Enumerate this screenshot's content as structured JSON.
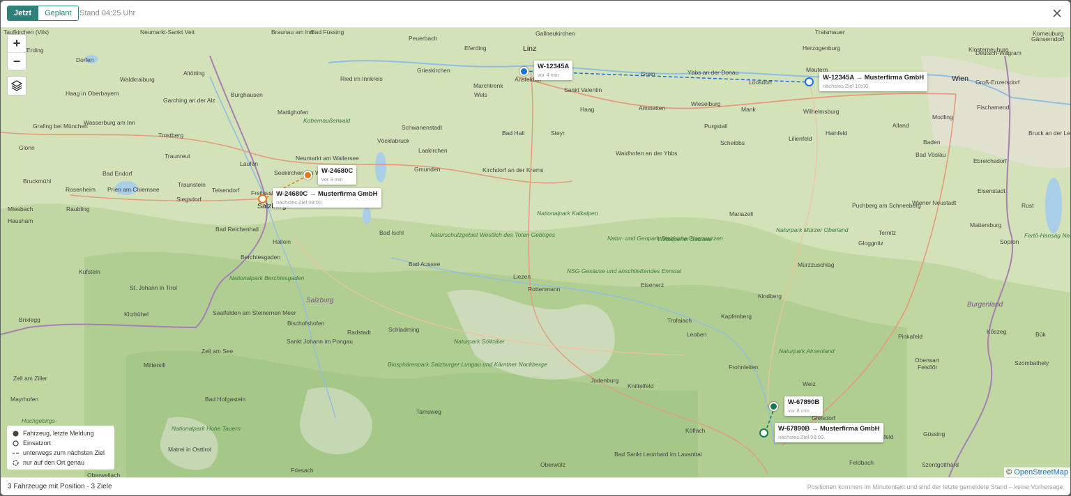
{
  "header": {
    "tabs": [
      {
        "label": "Jetzt"
      },
      {
        "label": "Geplant"
      }
    ],
    "stand": "Stand 04:25 Uhr"
  },
  "map": {
    "zoom_in": "+",
    "zoom_out": "−",
    "attribution_prefix": "©",
    "attribution_link": "OpenStreetMap",
    "places": [
      {
        "name": "Taufkirchen (Vils)"
      },
      {
        "name": "Neumarkt-Sankt Veit"
      },
      {
        "name": "Erding"
      },
      {
        "name": "Dorfen"
      },
      {
        "name": "Braunau am Inn"
      },
      {
        "name": "Bad Füssing"
      },
      {
        "name": "Peuerbach"
      },
      {
        "name": "Gallneukirchen"
      },
      {
        "name": "Traismauer"
      },
      {
        "name": "Korneuburg"
      },
      {
        "name": "Gänserndorf"
      },
      {
        "name": "Linz"
      },
      {
        "name": "Herzogenburg"
      },
      {
        "name": "Klosterneuburg"
      },
      {
        "name": "Deutsch-Wagram"
      },
      {
        "name": "Altötting"
      },
      {
        "name": "Eferding"
      },
      {
        "name": "Grieskirchen"
      },
      {
        "name": "Ansfelden"
      },
      {
        "name": "Grein"
      },
      {
        "name": "Melk"
      },
      {
        "name": "Waldkraiburg"
      },
      {
        "name": "Ried im Innkreis"
      },
      {
        "name": "Mautern"
      },
      {
        "name": "Ybbs an der Donau"
      },
      {
        "name": "Loosdorf"
      },
      {
        "name": "Wien"
      },
      {
        "name": "Groß-Enzersdorf"
      },
      {
        "name": "Haag in Oberbayern"
      },
      {
        "name": "Burghausen"
      },
      {
        "name": "Marchtrenk"
      },
      {
        "name": "Wels"
      },
      {
        "name": "Sankt Valentin"
      },
      {
        "name": "Haag"
      },
      {
        "name": "Amstetten"
      },
      {
        "name": "Wieselburg"
      },
      {
        "name": "Mank"
      },
      {
        "name": "Wilhelmsburg"
      },
      {
        "name": "Fischamend"
      },
      {
        "name": "Garching an der Alz"
      },
      {
        "name": "Mattighofen"
      },
      {
        "name": "Kobernaußerwald"
      },
      {
        "name": "Schwanenstadt"
      },
      {
        "name": "Wasserburg am Inn"
      },
      {
        "name": "Modling"
      },
      {
        "name": "Steyr"
      },
      {
        "name": "Bad Hall"
      },
      {
        "name": "Purgstall"
      },
      {
        "name": "Hainfeld"
      },
      {
        "name": "Alland"
      },
      {
        "name": "Grafing bei München"
      },
      {
        "name": "Trostberg"
      },
      {
        "name": "Vöcklabruck"
      },
      {
        "name": "Laakirchen"
      },
      {
        "name": "Scheibbs"
      },
      {
        "name": "Lilienfeld"
      },
      {
        "name": "Bruck an der Leitha"
      },
      {
        "name": "Glonn"
      },
      {
        "name": "Traunreut"
      },
      {
        "name": "Waidhofen an der Ybbs"
      },
      {
        "name": "Baden"
      },
      {
        "name": "Bad Vöslau"
      },
      {
        "name": "Neumarkt am Wallersee"
      },
      {
        "name": "Seekirchen am Wallersee"
      },
      {
        "name": "Gmunden"
      },
      {
        "name": "Kirchdorf an der Krems"
      },
      {
        "name": "Ebreichsdorf"
      },
      {
        "name": "Laufen"
      },
      {
        "name": "Bad Endorf"
      },
      {
        "name": "Bruckmühl"
      },
      {
        "name": "Traunstein"
      },
      {
        "name": "Rosenheim"
      },
      {
        "name": "Prien am Chiemsee"
      },
      {
        "name": "Teisendorf"
      },
      {
        "name": "Freilassing"
      },
      {
        "name": "Siegsdorf"
      },
      {
        "name": "Salzburg"
      },
      {
        "name": "Eisenstadt"
      },
      {
        "name": "Miesbach"
      },
      {
        "name": "Raubling"
      },
      {
        "name": "Hausham"
      },
      {
        "name": "Nationalpark Kalkalpen"
      },
      {
        "name": "Puchberg am Schneeberg"
      },
      {
        "name": "Wiener Neustadt"
      },
      {
        "name": "Rust"
      },
      {
        "name": "Mariazell"
      },
      {
        "name": "Bad Reichenhall"
      },
      {
        "name": "Bad Ischl"
      },
      {
        "name": "Naturpark Mürzer Oberland"
      },
      {
        "name": "Mattersburg"
      },
      {
        "name": "Naturschutzgebiet Westlich des Toten Gebirges"
      },
      {
        "name": "Hallein"
      },
      {
        "name": "Natur- und Geopark Steirische Eisenwurzen"
      },
      {
        "name": "Wildalpener Salzatal"
      },
      {
        "name": "Gloggnitz"
      },
      {
        "name": "Ternitz"
      },
      {
        "name": "Sopron"
      },
      {
        "name": "Fertő-Hanság Nemzeti Park"
      },
      {
        "name": "Berchtesgaden"
      },
      {
        "name": "Bad Aussee"
      },
      {
        "name": "NSG Gesäuse und anschließendes Ennstal"
      },
      {
        "name": "Mürzzuschlag"
      },
      {
        "name": "Kufstein"
      },
      {
        "name": "Liezen"
      },
      {
        "name": "Nationalpark Berchtesgaden"
      },
      {
        "name": "Rottenmann"
      },
      {
        "name": "Eisenerz"
      },
      {
        "name": "St. Johann in Tirol"
      },
      {
        "name": "Salzburg"
      },
      {
        "name": "Kindberg"
      },
      {
        "name": "Burgenland"
      },
      {
        "name": "Kitzbühel"
      },
      {
        "name": "Saalfelden am Steinernen Meer"
      },
      {
        "name": "Bischofshofen"
      },
      {
        "name": "Trofaiach"
      },
      {
        "name": "Kapfenberg"
      },
      {
        "name": "Brixlegg"
      },
      {
        "name": "Schladming"
      },
      {
        "name": "Radstadt"
      },
      {
        "name": "Leoben"
      },
      {
        "name": "Pinkafeld"
      },
      {
        "name": "Bük"
      },
      {
        "name": "Kőszeg"
      },
      {
        "name": "Zell am See"
      },
      {
        "name": "Sankt Johann im Pongau"
      },
      {
        "name": "Naturpark Sölktäler"
      },
      {
        "name": "Naturpark Almenland"
      },
      {
        "name": "Oberwart"
      },
      {
        "name": "Felsőőr"
      },
      {
        "name": "Frohnleiten"
      },
      {
        "name": "Weiz"
      },
      {
        "name": "Mittersill"
      },
      {
        "name": "Biosphärenpark Salzburger Lungau und Kärntner Nockberge"
      },
      {
        "name": "Knittelfeld"
      },
      {
        "name": "Szombathely"
      },
      {
        "name": "Zell am Ziller"
      },
      {
        "name": "Judenburg"
      },
      {
        "name": "Gleisdorf"
      },
      {
        "name": "Mayrhofen"
      },
      {
        "name": "Bad Hofgastein"
      },
      {
        "name": "Tamsweg"
      },
      {
        "name": "Hochgebirgs-"
      },
      {
        "name": "Nationalpark Hohe Tauern"
      },
      {
        "name": "Köflach"
      },
      {
        "name": "Fürstenfeld"
      },
      {
        "name": "Güssing"
      },
      {
        "name": "Matrei in Osttirol"
      },
      {
        "name": "Bad Sankt Leonhard im Lavanttal"
      },
      {
        "name": "Feldbach"
      },
      {
        "name": "Szentgotthárd"
      },
      {
        "name": "Oberwölz"
      },
      {
        "name": "Friesach"
      },
      {
        "name": "Oberwellach"
      }
    ],
    "vehicles": [
      {
        "name": "W-12345A",
        "sub": "vor 4 min",
        "color": "#1d6fe0",
        "target": "W-12345A → Musterfirma GmbH",
        "target_sub": "nächstes Ziel 10:00"
      },
      {
        "name": "W-24680C",
        "sub": "vor 3 min",
        "color": "#e8771a",
        "target": "W-24680C → Musterfirma GmbH",
        "target_sub": "nächstes Ziel 09:00"
      },
      {
        "name": "W-67890B",
        "sub": "vor 8 min",
        "color": "#157a4e",
        "target": "W-67890B → Musterfirma GmbH",
        "target_sub": "nächstes Ziel 08:00"
      }
    ]
  },
  "legend": {
    "vehicle": "Fahrzeug, letzte Meldung",
    "site": "Einsatzort",
    "en_route": "unterwegs zum nächsten Ziel",
    "approx": "nur auf den Ort genau"
  },
  "footer": {
    "left": "3 Fahrzeuge mit Position · 3 Ziele",
    "right": "Positionen kommen im Minutentakt und sind der letzte gemeldete Stand – keine Vorhersage."
  }
}
